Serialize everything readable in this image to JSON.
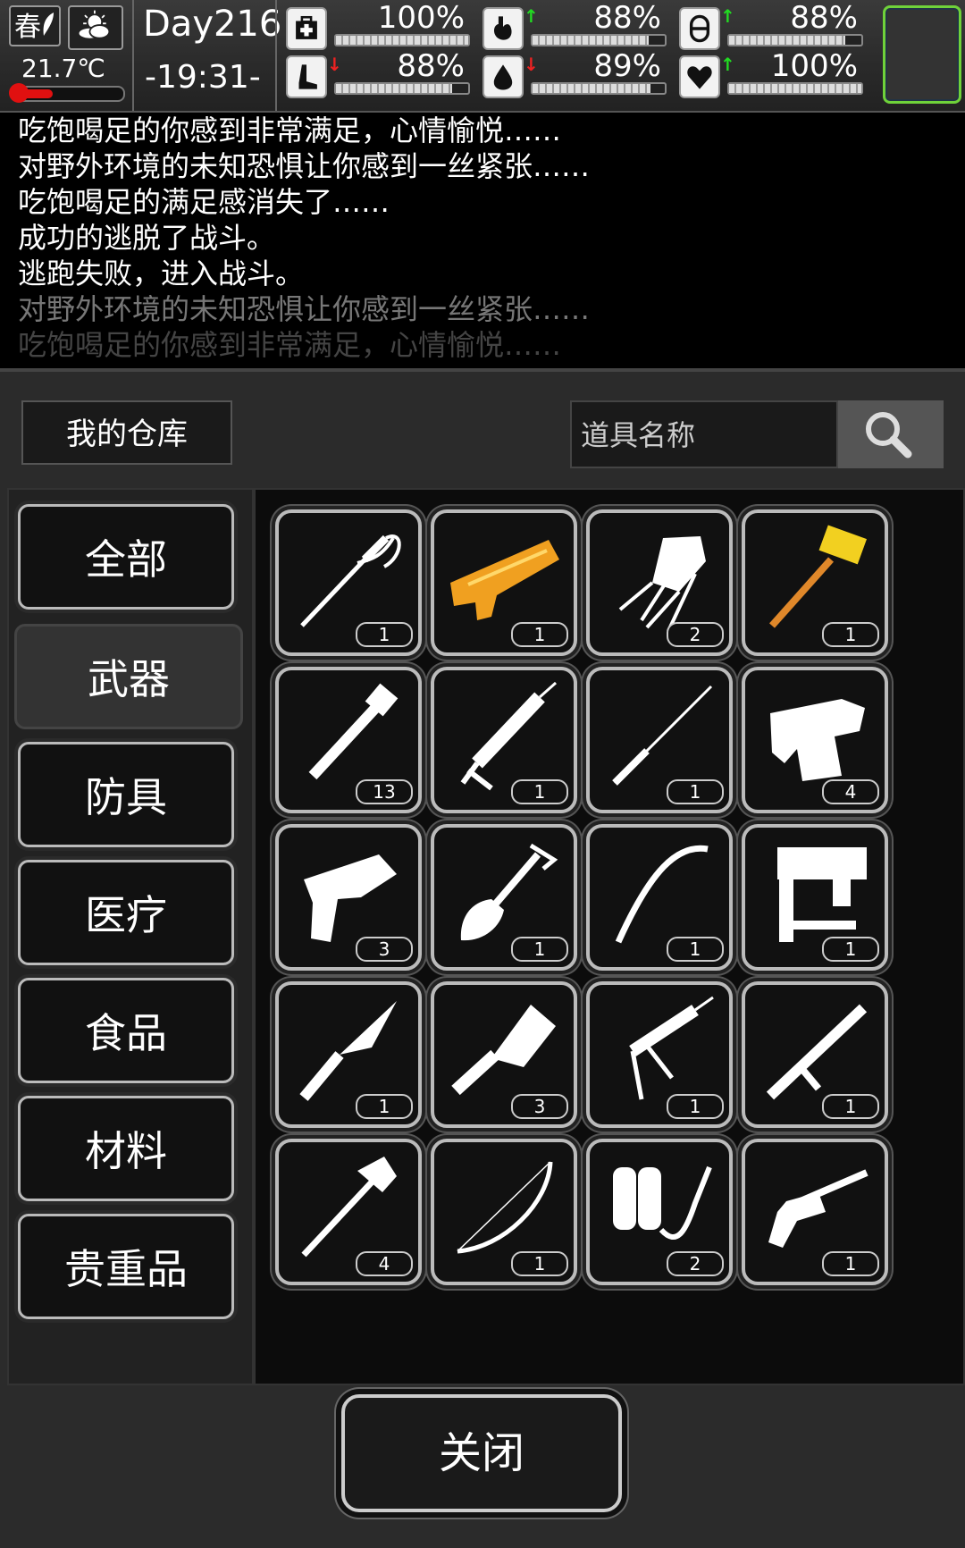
{
  "hud": {
    "season": "春",
    "temperature": "21.7℃",
    "temperature_level": 0.35,
    "day": "Day216",
    "time": "-19:31-",
    "stats": [
      {
        "name": "health",
        "icon": "medkit-icon",
        "arrow": "",
        "value": "100%",
        "level": 1.0
      },
      {
        "name": "hunger",
        "icon": "stomach-icon",
        "arrow": "↑",
        "arrow_color": "#22dd22",
        "value": "88%",
        "level": 0.88
      },
      {
        "name": "energy",
        "icon": "capsule-icon",
        "arrow": "↑",
        "arrow_color": "#22dd22",
        "value": "88%",
        "level": 0.88
      },
      {
        "name": "stamina",
        "icon": "foot-icon",
        "arrow": "↓",
        "arrow_color": "#ee2222",
        "value": "88%",
        "level": 0.88
      },
      {
        "name": "thirst",
        "icon": "water-drop-icon",
        "arrow": "↓",
        "arrow_color": "#ee2222",
        "value": "89%",
        "level": 0.89
      },
      {
        "name": "mood",
        "icon": "heart-icon",
        "arrow": "↑",
        "arrow_color": "#22dd22",
        "value": "100%",
        "level": 1.0
      }
    ]
  },
  "log": {
    "lines": [
      "吃饱喝足的你感到非常满足，心情愉悦……",
      "对野外环境的未知恐惧让你感到一丝紧张……",
      "吃饱喝足的满足感消失了……",
      "成功的逃脱了战斗。",
      "逃跑失败，进入战斗。",
      "对野外环境的未知恐惧让你感到一丝紧张……",
      "吃饱喝足的你感到非常满足，心情愉悦……"
    ]
  },
  "warehouse": {
    "title": "我的仓库",
    "search_placeholder": "道具名称",
    "categories": [
      "全部",
      "武器",
      "防具",
      "医疗",
      "食品",
      "材料",
      "贵重品"
    ],
    "active_category": "武器",
    "close_label": "关闭",
    "items": [
      {
        "name": "fencing-sword",
        "count": "1"
      },
      {
        "name": "orange-blaster",
        "count": "1"
      },
      {
        "name": "folding-chair",
        "count": "2"
      },
      {
        "name": "golden-hammer",
        "count": "1"
      },
      {
        "name": "pipe-wrench",
        "count": "13"
      },
      {
        "name": "caulking-gun",
        "count": "1"
      },
      {
        "name": "thin-spear",
        "count": "1"
      },
      {
        "name": "blowtorch",
        "count": "4"
      },
      {
        "name": "scifi-pistol",
        "count": "3"
      },
      {
        "name": "shovel",
        "count": "1"
      },
      {
        "name": "crowbar",
        "count": "1"
      },
      {
        "name": "nail-gun",
        "count": "1"
      },
      {
        "name": "combat-knife",
        "count": "1"
      },
      {
        "name": "cleaver",
        "count": "3"
      },
      {
        "name": "injector-gun",
        "count": "1"
      },
      {
        "name": "tonfa",
        "count": "1"
      },
      {
        "name": "fire-axe",
        "count": "4"
      },
      {
        "name": "recurve-bow",
        "count": "1"
      },
      {
        "name": "flamethrower",
        "count": "2"
      },
      {
        "name": "revolver",
        "count": "1"
      }
    ]
  }
}
